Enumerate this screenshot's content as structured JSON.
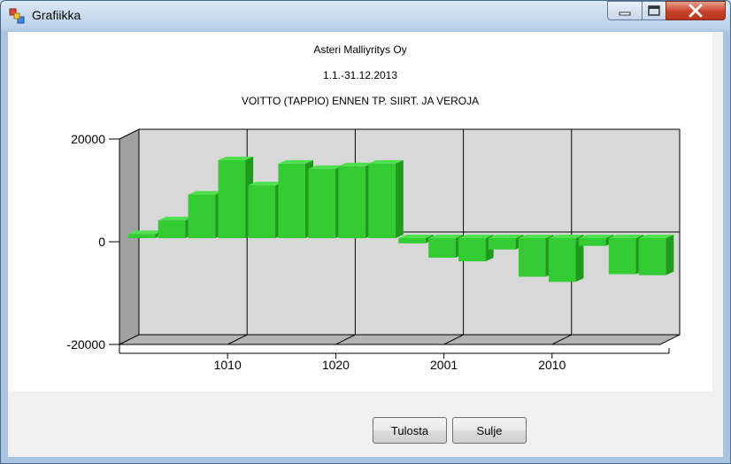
{
  "window": {
    "title": "Grafiikka"
  },
  "chart_title": {
    "line1": "Asteri Malliyritys Oy",
    "line2": "1.1.-31.12.2013",
    "line3": "VOITTO (TAPPIO) ENNEN TP. SIIRT. JA VEROJA"
  },
  "chart_data": {
    "type": "bar",
    "title": "VOITTO (TAPPIO) ENNEN TP. SIIRT. JA VEROJA",
    "y_ticks": [
      "20000",
      "0",
      "-20000"
    ],
    "x_tick_labels": [
      "1010",
      "1020",
      "2001",
      "2010"
    ],
    "ylim": [
      -20000,
      20000
    ],
    "values": [
      800,
      3500,
      8500,
      15200,
      10300,
      14500,
      13500,
      14000,
      14500,
      -1000,
      -3800,
      -4500,
      -2200,
      -7500,
      -8500,
      -1500,
      -7000,
      -7200
    ],
    "bar_color": "#33cc33",
    "grid": true
  },
  "buttons": {
    "print": "Tulosta",
    "close": "Sulje"
  }
}
